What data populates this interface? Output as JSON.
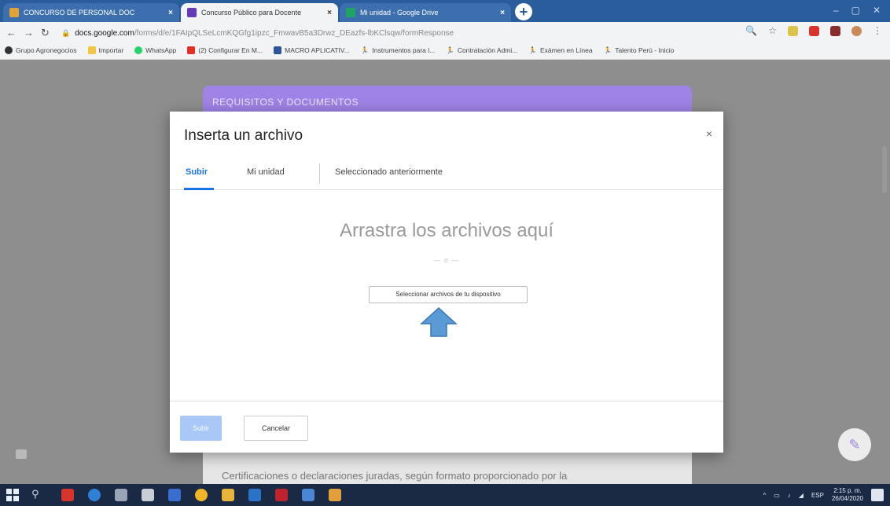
{
  "browser": {
    "tabs": [
      {
        "label": "CONCURSO DE PERSONAL DOC",
        "active": false,
        "favicon_color": "#e0a23a"
      },
      {
        "label": "Concurso Público para Docente",
        "active": true,
        "favicon_color": "#673ab7"
      },
      {
        "label": "Mi unidad - Google Drive",
        "active": false,
        "favicon_color": "#1fa463"
      }
    ],
    "url_host": "docs.google.com",
    "url_path": "/forms/d/e/1FAIpQLSeLcmKQGfg1ipzc_FmwavB5a3Drwz_DEazfs-lbKClsqw/formResponse",
    "bookmarks": [
      {
        "label": "Grupo Agronegocios",
        "color": "#333333"
      },
      {
        "label": "Importar",
        "color": "#f4c542"
      },
      {
        "label": "WhatsApp",
        "color": "#25d366"
      },
      {
        "label": "(2) Configurar En M...",
        "color": "#e52d27"
      },
      {
        "label": "MACRO APLICATIV...",
        "color": "#2b579a"
      },
      {
        "label": "Instrumentos para l...",
        "color": "#222222"
      },
      {
        "label": "Contratación Admi...",
        "color": "#222222"
      },
      {
        "label": "Exámen en Línea",
        "color": "#222222"
      },
      {
        "label": "Talento Perú - Inicio",
        "color": "#222222"
      }
    ]
  },
  "form": {
    "section_title": "REQUISITOS Y DOCUMENTOS",
    "bottom_text": "Certificaciones o declaraciones juradas, según formato proporcionado por la"
  },
  "dialog": {
    "title": "Inserta un archivo",
    "close": "×",
    "tabs": {
      "upload": "Subir",
      "my_drive": "Mi unidad",
      "recent": "Seleccionado anteriormente"
    },
    "drop_text": "Arrastra los archivos aquí",
    "or_text": "— o —",
    "select_button": "Seleccionar archivos de tu dispositivo",
    "upload_button": "Subir",
    "cancel_button": "Cancelar"
  },
  "taskbar": {
    "language": "ESP",
    "time": "2:15 p. m.",
    "date": "26/04/2020"
  },
  "colors": {
    "accent": "#1a73e8",
    "form_header": "#9f83e6",
    "arrow": "#5b9bd5"
  }
}
